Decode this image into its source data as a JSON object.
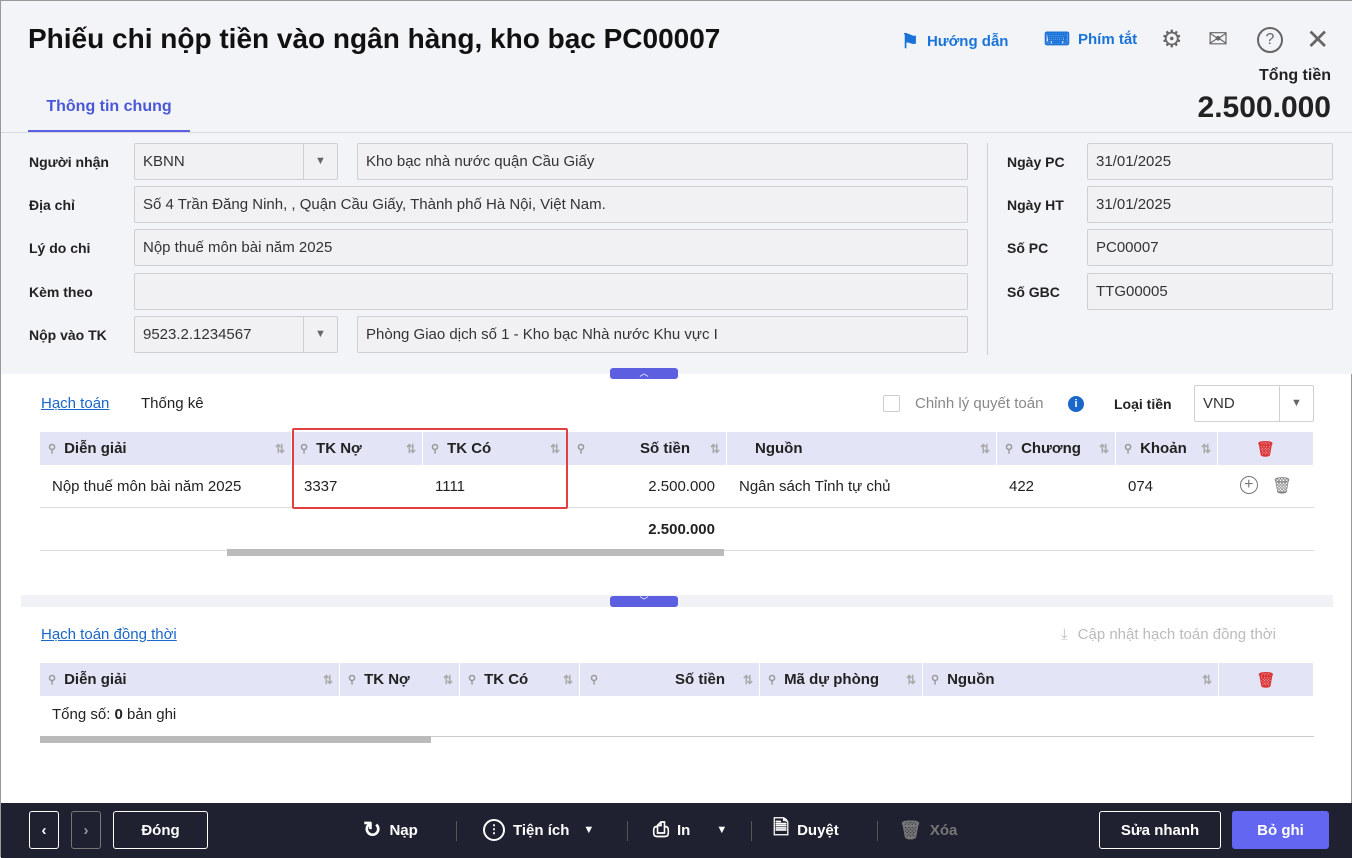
{
  "header": {
    "title": "Phiếu chi nộp tiền vào ngân hàng, kho bạc PC00007",
    "guide": "Hướng dẫn",
    "shortcuts": "Phím tắt",
    "total_label": "Tổng tiền",
    "total_value": "2.500.000"
  },
  "tabs": [
    {
      "label": "Thông tin chung"
    }
  ],
  "form": {
    "nguoi_nhan_label": "Người nhận",
    "nguoi_nhan": "KBNN",
    "nguoi_nhan_name": "Kho bạc nhà nước quận Cầu Giấy",
    "dia_chi_label": "Địa chỉ",
    "dia_chi": "Số 4 Trần Đăng Ninh, , Quận Cầu Giấy, Thành phố Hà Nội, Việt Nam.",
    "ly_do_label": "Lý do chi",
    "ly_do": "Nộp thuế môn bài năm 2025",
    "kem_theo_label": "Kèm theo",
    "kem_theo": "",
    "nop_vao_label": "Nộp vào TK",
    "nop_vao": "9523.2.1234567",
    "nop_vao_name": "Phòng Giao dịch số 1 - Kho bạc Nhà nước Khu vực I",
    "ngay_pc_label": "Ngày PC",
    "ngay_pc": "31/01/2025",
    "ngay_ht_label": "Ngày HT",
    "ngay_ht": "31/01/2025",
    "so_pc_label": "Số PC",
    "so_pc": "PC00007",
    "so_gbc_label": "Số GBC",
    "so_gbc": "TTG00005"
  },
  "section1": {
    "tab_active": "Hạch toán",
    "tab2": "Thống kê",
    "chinh_ly": "Chỉnh lý quyết toán",
    "loai_tien_label": "Loại tiền",
    "loai_tien": "VND",
    "columns": [
      "Diễn giải",
      "TK Nợ",
      "TK Có",
      "Số tiền",
      "Nguồn",
      "Chương",
      "Khoản"
    ],
    "rows": [
      {
        "dien_giai": "Nộp thuế môn bài năm 2025",
        "tk_no": "3337",
        "tk_co": "1111",
        "so_tien": "2.500.000",
        "nguon": "Ngân sách Tỉnh tự chủ",
        "chuong": "422",
        "khoan": "074"
      }
    ],
    "total": "2.500.000"
  },
  "section2": {
    "title": "Hạch toán đồng thời",
    "update": "Cập nhật hạch toán đồng thời",
    "columns": [
      "Diễn giải",
      "TK Nợ",
      "TK Có",
      "Số tiền",
      "Mã dự phòng",
      "Nguồn"
    ],
    "count_prefix": "Tổng số: ",
    "count": "0",
    "count_suffix": " bản ghi"
  },
  "footer": {
    "close": "Đóng",
    "reload": "Nạp",
    "utilities": "Tiện ích",
    "print": "In",
    "approve": "Duyệt",
    "delete": "Xóa",
    "quick_edit": "Sửa nhanh",
    "unpost": "Bỏ ghi"
  },
  "colors": {
    "accent": "#5b5fe0",
    "link": "#1a73d9",
    "highlight": "#e04040"
  }
}
